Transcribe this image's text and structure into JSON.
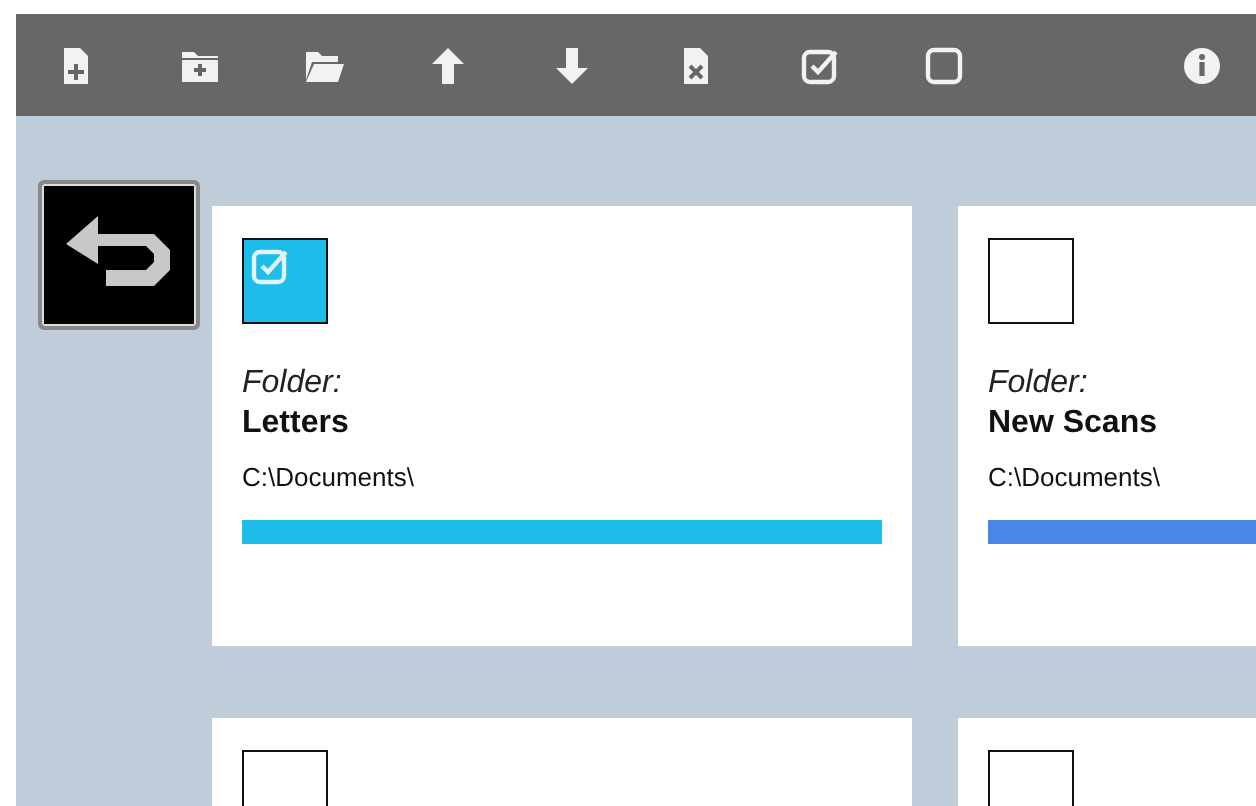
{
  "toolbar": {
    "buttons": [
      {
        "kind": "new-file"
      },
      {
        "kind": "new-folder"
      },
      {
        "kind": "open-folder"
      },
      {
        "kind": "up"
      },
      {
        "kind": "down"
      },
      {
        "kind": "delete-file"
      },
      {
        "kind": "check-all"
      },
      {
        "kind": "uncheck-all"
      },
      {
        "kind": "info"
      }
    ]
  },
  "cards": [
    {
      "selected": true,
      "color": "#1ebde9",
      "label": "Folder:",
      "name": "Letters",
      "path": "C:\\Documents\\"
    },
    {
      "selected": false,
      "color": "#4a86e8",
      "label": "Folder:",
      "name": "New Scans",
      "path": "C:\\Documents\\"
    },
    {
      "selected": false
    },
    {
      "selected": false
    }
  ]
}
